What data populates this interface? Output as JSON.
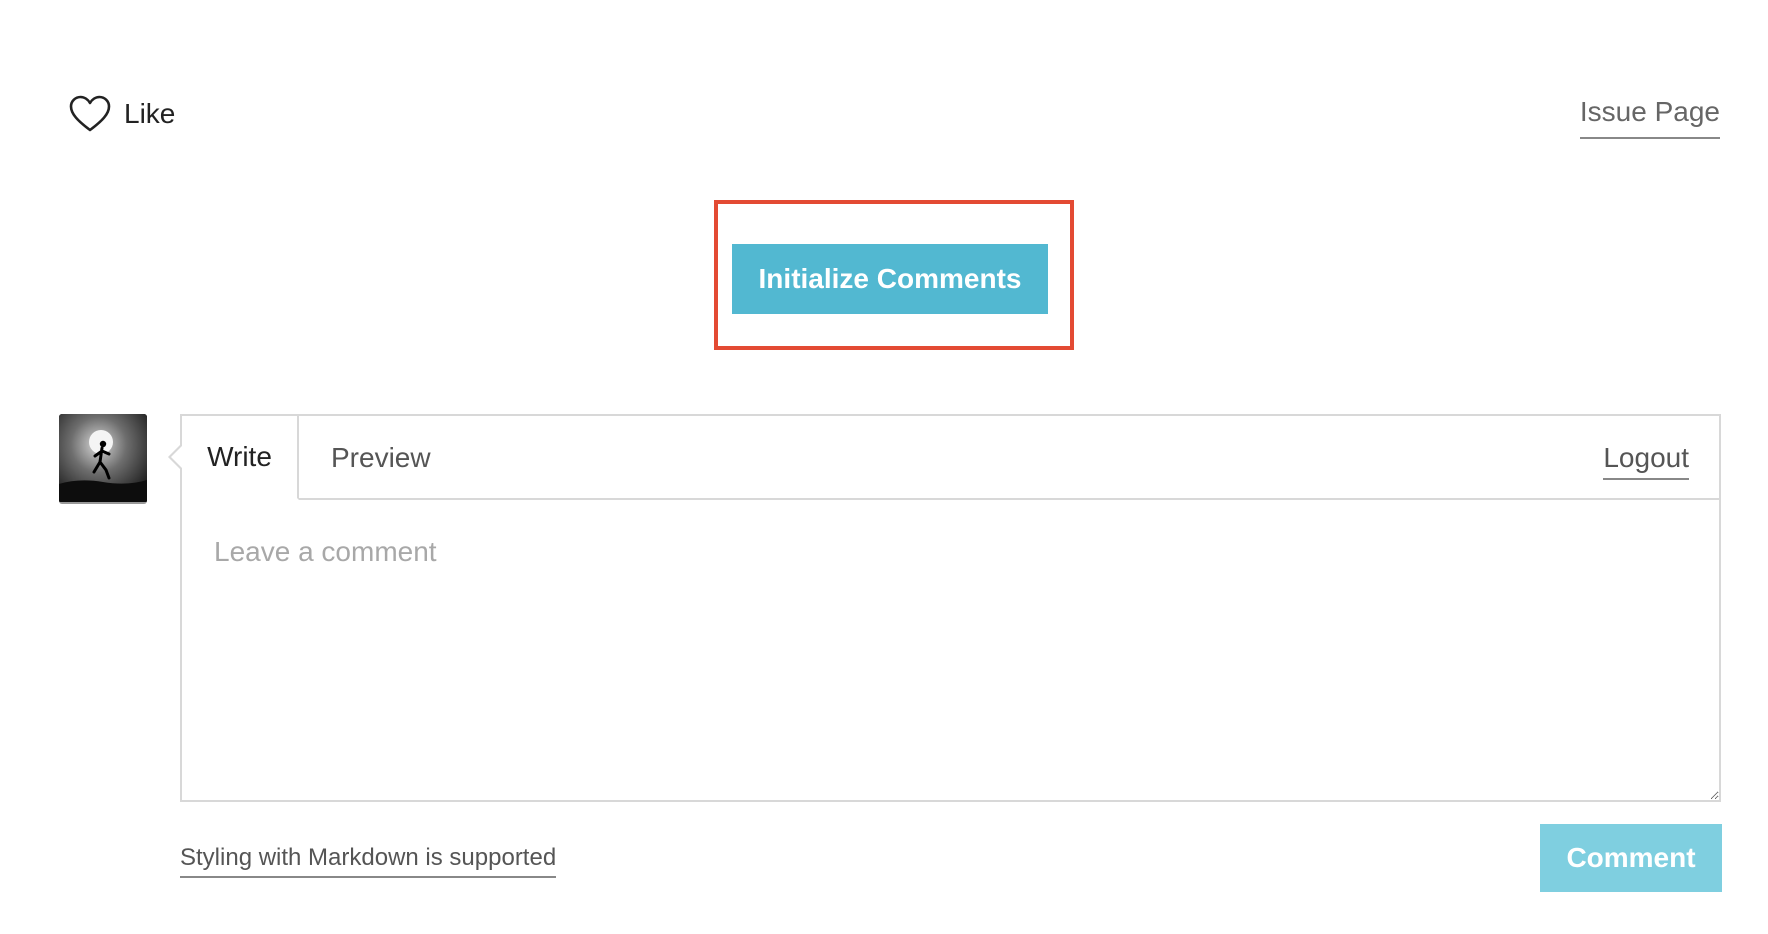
{
  "header": {
    "like": {
      "icon": "heart-icon",
      "label": "Like"
    },
    "issue_link": "Issue Page"
  },
  "init": {
    "button_label": "Initialize Comments",
    "button_color": "#52b8d1",
    "highlight_color": "#e34a33"
  },
  "comment": {
    "avatar": "user-avatar",
    "tabs": [
      {
        "label": "Write",
        "active": true
      },
      {
        "label": "Preview",
        "active": false
      }
    ],
    "logout": "Logout",
    "textarea_placeholder": "Leave a comment",
    "textarea_value": "",
    "markdown_note": "Styling with Markdown is supported",
    "submit_label": "Comment",
    "submit_color": "#7fcfe0",
    "submit_disabled": true
  }
}
